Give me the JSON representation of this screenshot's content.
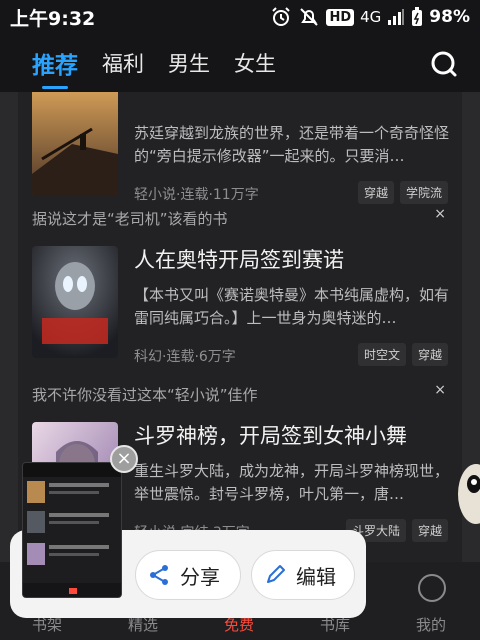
{
  "status_bar": {
    "time": "上午9:32",
    "hd_badge": "HD",
    "network": "4G",
    "battery": "98%"
  },
  "tabs": [
    {
      "label": "推荐",
      "active": true
    },
    {
      "label": "福利",
      "active": false
    },
    {
      "label": "男生",
      "active": false
    },
    {
      "label": "女生",
      "active": false
    }
  ],
  "feed": {
    "book1": {
      "desc": "苏廷穿越到龙族的世界，还是带着一个奇奇怪怪的“旁白提示修改器”一起来的。只要消…",
      "meta": "轻小说·连载·11万字",
      "tags": [
        "穿越",
        "学院流"
      ]
    },
    "section2": {
      "heading": "据说这才是“老司机”该看的书",
      "close": "×"
    },
    "book2": {
      "title": "人在奥特开局签到赛诺",
      "desc": "【本书又叫《赛诺奥特曼》本书纯属虚构，如有雷同纯属巧合。】上一世身为奥特迷的…",
      "meta": "科幻·连载·6万字",
      "tags": [
        "时空文",
        "穿越"
      ]
    },
    "section3": {
      "heading": "我不许你没看过这本“轻小说”佳作",
      "close": "×"
    },
    "book3": {
      "title": "斗罗神榜，开局签到女神小舞",
      "desc": "重生斗罗大陆，成为龙神，开局斗罗神榜现世，举世震惊。封号斗罗榜，叶凡第一，唐…",
      "meta": "轻小说·完结·3万字",
      "tags": [
        "斗罗大陆",
        "穿越"
      ]
    }
  },
  "bottom_nav": [
    {
      "label": "书架",
      "active": false
    },
    {
      "label": "精选",
      "active": false
    },
    {
      "label": "免费",
      "active": true
    },
    {
      "label": "书库",
      "active": false
    },
    {
      "label": "我的",
      "active": false
    }
  ],
  "share_sheet": {
    "share_label": "分享",
    "edit_label": "编辑",
    "close_glyph": "×"
  },
  "colors": {
    "accent": "#2aa3ff",
    "active_nav": "#ff4a3a"
  }
}
